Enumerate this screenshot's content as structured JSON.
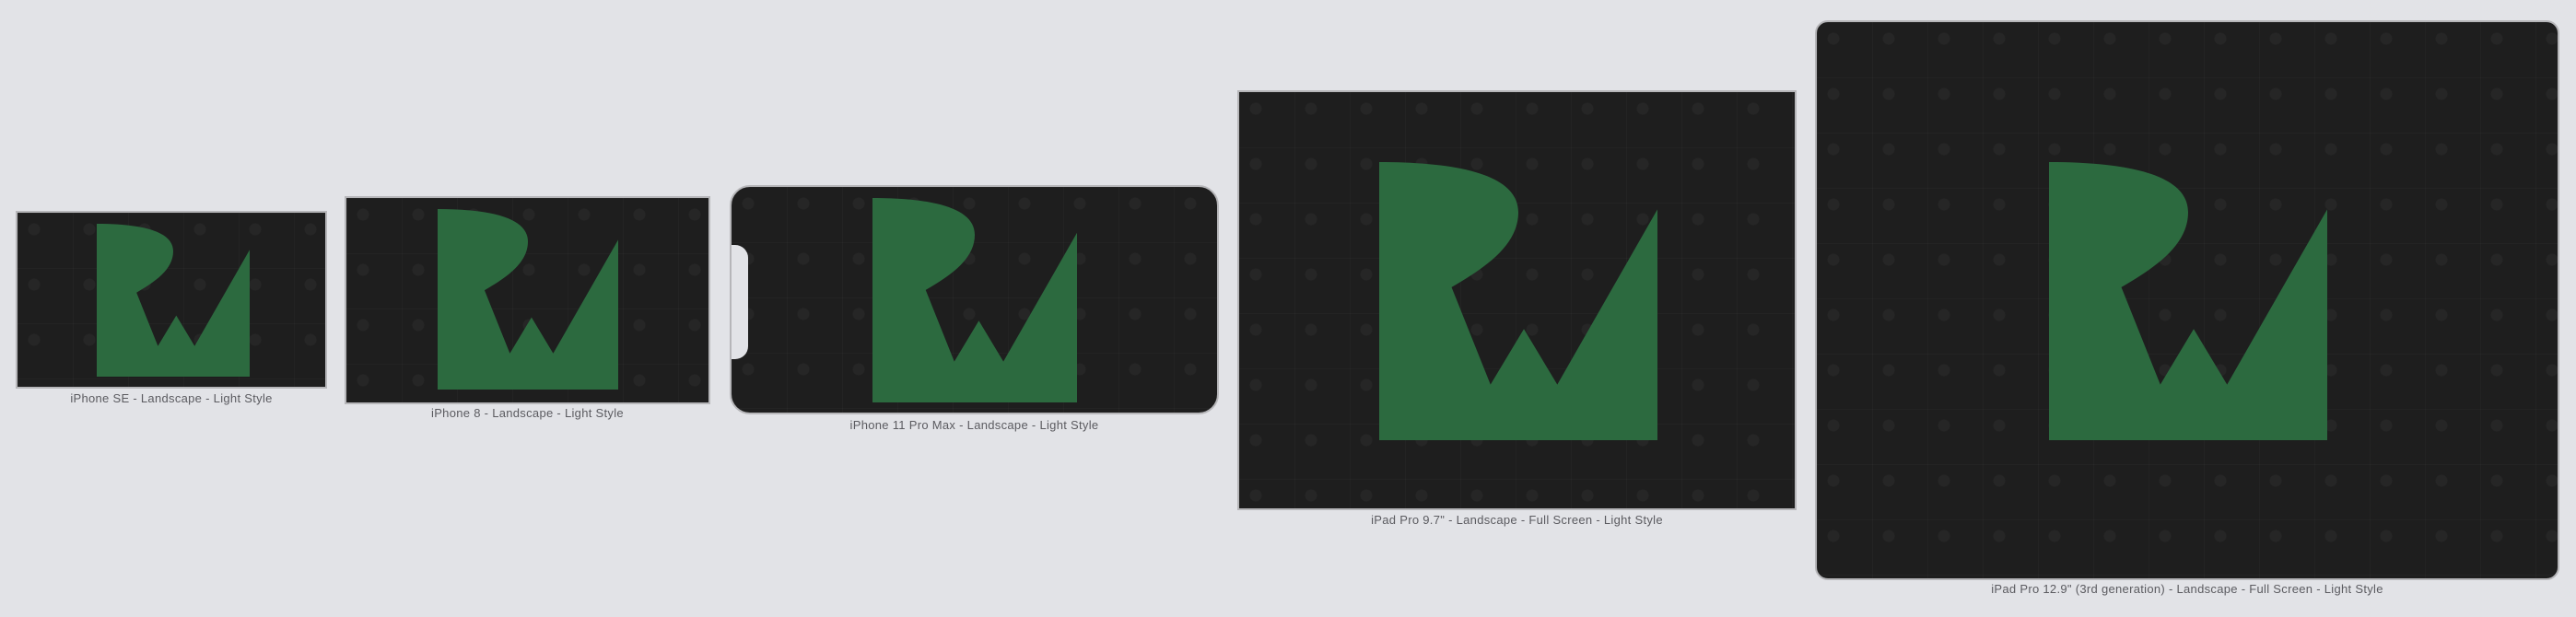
{
  "colors": {
    "canvas": "#e2e3e7",
    "screen": "#1e1e1e",
    "logo": "#2c6a3f",
    "caption": "#5b5b60"
  },
  "previews": [
    {
      "caption": "iPhone SE - Landscape - Light Style",
      "logo": "rw-logo-icon"
    },
    {
      "caption": "iPhone 8 - Landscape - Light Style",
      "logo": "rw-logo-icon"
    },
    {
      "caption": "iPhone 11 Pro Max - Landscape - Light Style",
      "logo": "rw-logo-icon"
    },
    {
      "caption": "iPad Pro 9.7\" - Landscape - Full Screen - Light Style",
      "logo": "rw-logo-icon"
    },
    {
      "caption": "iPad Pro 12.9\" (3rd generation) - Landscape - Full Screen - Light Style",
      "logo": "rw-logo-icon"
    }
  ]
}
